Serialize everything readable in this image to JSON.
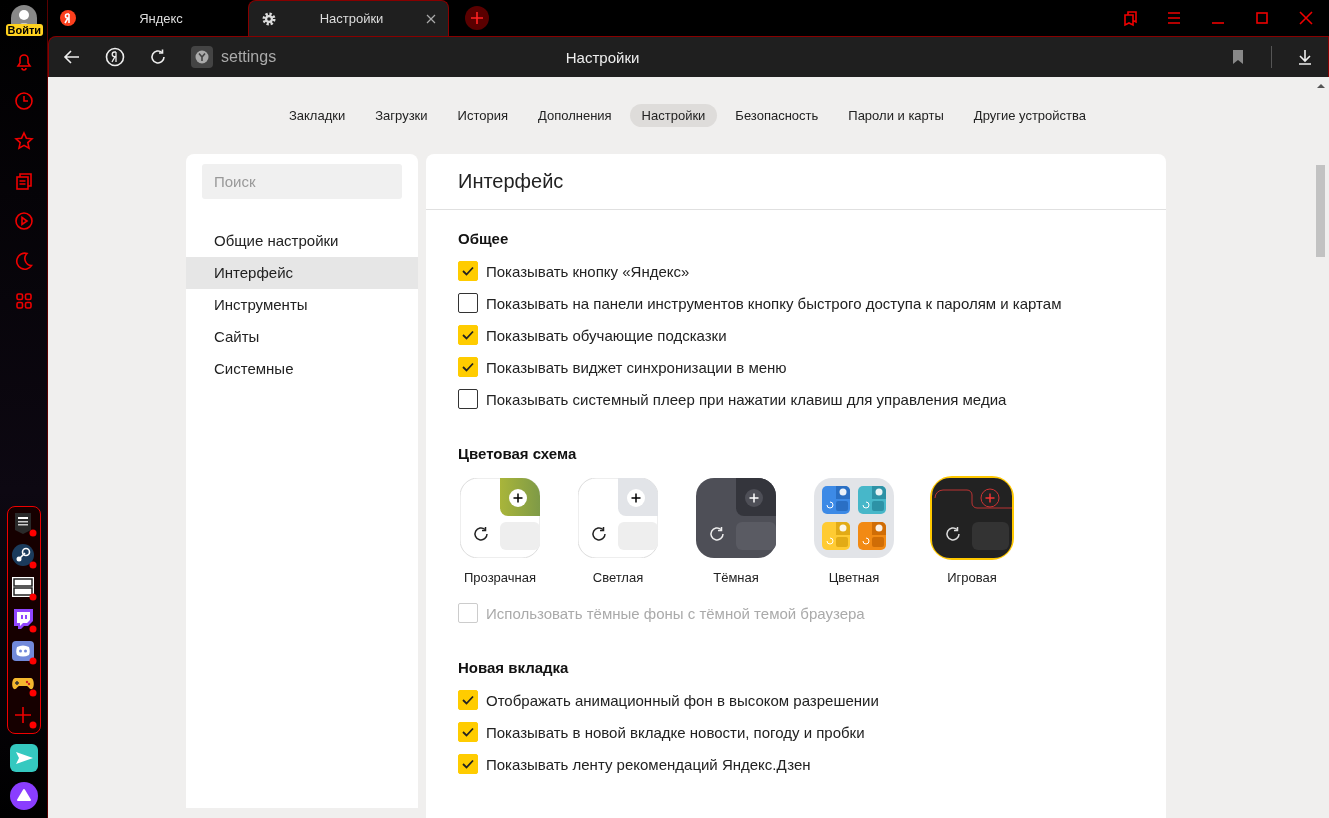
{
  "profile": {
    "login_badge": "Войти"
  },
  "tabs": [
    {
      "title": "Яндекс",
      "selected": false,
      "kind": "yandex"
    },
    {
      "title": "Настройки",
      "selected": true,
      "kind": "gear"
    }
  ],
  "toolbar": {
    "address": "settings",
    "page_title": "Настройки"
  },
  "settings_nav": [
    {
      "label": "Закладки",
      "selected": false
    },
    {
      "label": "Загрузки",
      "selected": false
    },
    {
      "label": "История",
      "selected": false
    },
    {
      "label": "Дополнения",
      "selected": false
    },
    {
      "label": "Настройки",
      "selected": true
    },
    {
      "label": "Безопасность",
      "selected": false
    },
    {
      "label": "Пароли и карты",
      "selected": false
    },
    {
      "label": "Другие устройства",
      "selected": false
    }
  ],
  "sidebar_search": {
    "placeholder": "Поиск"
  },
  "sections": [
    {
      "label": "Общие настройки",
      "selected": false
    },
    {
      "label": "Интерфейс",
      "selected": true
    },
    {
      "label": "Инструменты",
      "selected": false
    },
    {
      "label": "Сайты",
      "selected": false
    },
    {
      "label": "Системные",
      "selected": false
    }
  ],
  "panel": {
    "title": "Интерфейс",
    "groups": [
      {
        "heading": "Общее",
        "options": [
          {
            "label": "Показывать кнопку «Яндекс»",
            "checked": true,
            "disabled": false
          },
          {
            "label": "Показывать на панели инструментов кнопку быстрого доступа к паролям и картам",
            "checked": false,
            "disabled": false
          },
          {
            "label": "Показывать обучающие подсказки",
            "checked": true,
            "disabled": false
          },
          {
            "label": "Показывать виджет синхронизации в меню",
            "checked": true,
            "disabled": false
          },
          {
            "label": "Показывать системный плеер при нажатии клавиш для управления медиа",
            "checked": false,
            "disabled": false
          }
        ]
      },
      {
        "heading": "Цветовая схема",
        "themes": [
          {
            "label": "Прозрачная",
            "kind": "transparent",
            "selected": false
          },
          {
            "label": "Светлая",
            "kind": "light",
            "selected": false
          },
          {
            "label": "Тёмная",
            "kind": "dark",
            "selected": false
          },
          {
            "label": "Цветная",
            "kind": "colored",
            "selected": false
          },
          {
            "label": "Игровая",
            "kind": "game",
            "selected": true
          }
        ],
        "options": [
          {
            "label": "Использовать тёмные фоны с тёмной темой браузера",
            "checked": false,
            "disabled": true
          }
        ]
      },
      {
        "heading": "Новая вкладка",
        "options": [
          {
            "label": "Отображать анимационный фон в высоком разрешении",
            "checked": true,
            "disabled": false
          },
          {
            "label": "Показывать в новой вкладке новости, погоду и пробки",
            "checked": true,
            "disabled": false
          },
          {
            "label": "Показывать ленту рекомендаций Яндекс.Дзен",
            "checked": true,
            "disabled": false
          }
        ]
      }
    ]
  }
}
